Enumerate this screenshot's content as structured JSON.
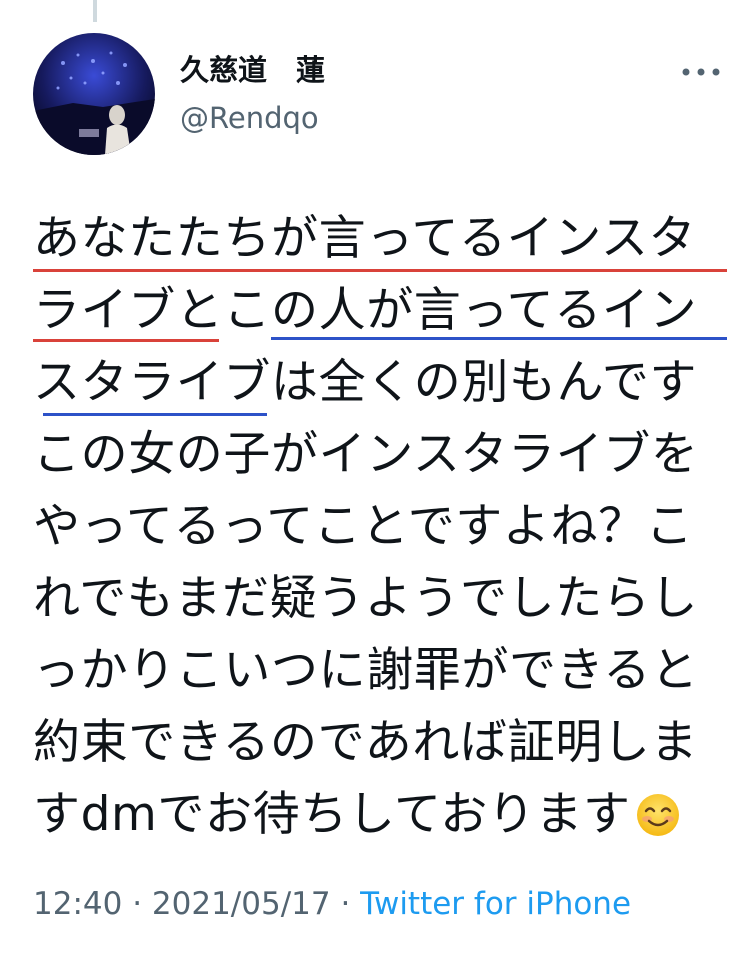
{
  "tweet": {
    "author": {
      "display_name": "久慈道　蓮",
      "handle": "@Rendqo",
      "avatar_icon": "profile-photo"
    },
    "more_icon": "more-horizontal-icon",
    "text_lines": [
      "あなたたちが言ってるインスタ",
      "ライブとこの人が言ってるイン",
      "スタライブは全くの別もんです",
      "この女の子がインスタライブを",
      "やってるってことですよね？こ",
      "れでもまだ疑うようでしたらし",
      "っかりこいつに謝罪ができると",
      "約束できるのであれば証明しま",
      "すdmでお待ちしております"
    ],
    "emoji": "smiling-face-emoji",
    "time": "12:40",
    "separator": " · ",
    "date": "2021/05/17",
    "source": "Twitter for iPhone"
  },
  "colors": {
    "text": "#0f1419",
    "secondary": "#536471",
    "link": "#1d9bf0",
    "underline_red": "#d9423a",
    "underline_blue": "#2d52c8"
  }
}
